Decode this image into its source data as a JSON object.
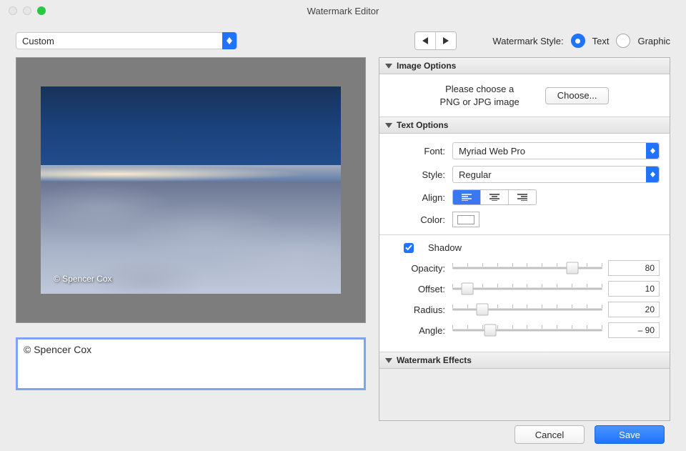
{
  "window_title": "Watermark Editor",
  "preset": {
    "selected": "Custom"
  },
  "style": {
    "label": "Watermark Style:",
    "options": {
      "text": "Text",
      "graphic": "Graphic"
    },
    "selected": "text"
  },
  "sections": {
    "image": {
      "title": "Image Options",
      "message1": "Please choose a",
      "message2": "PNG or JPG image",
      "choose": "Choose..."
    },
    "text": {
      "title": "Text Options",
      "font_label": "Font:",
      "font_value": "Myriad Web Pro",
      "style_label": "Style:",
      "style_value": "Regular",
      "align_label": "Align:",
      "color_label": "Color:",
      "shadow_label": "Shadow",
      "opacity": {
        "label": "Opacity:",
        "value": 80,
        "pct": 80
      },
      "offset": {
        "label": "Offset:",
        "value": 10,
        "pct": 10
      },
      "radius": {
        "label": "Radius:",
        "value": 20,
        "pct": 20
      },
      "angle": {
        "label": "Angle:",
        "value": "– 90",
        "pct": 25
      }
    },
    "effects": {
      "title": "Watermark Effects"
    }
  },
  "watermark_text": "© Spencer Cox",
  "footer": {
    "cancel": "Cancel",
    "save": "Save"
  }
}
